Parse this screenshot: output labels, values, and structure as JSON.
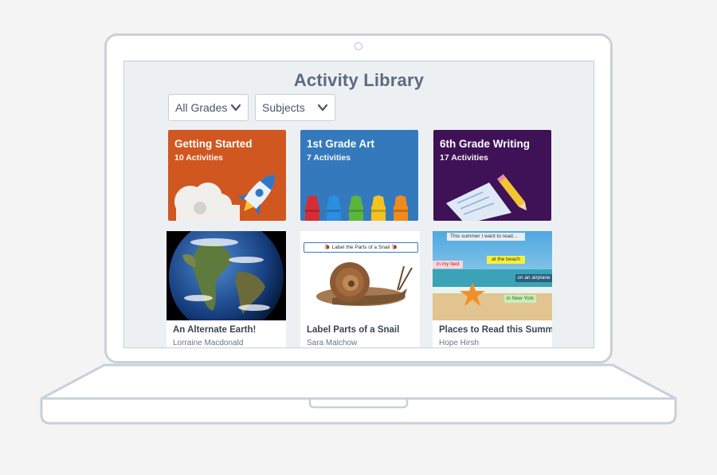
{
  "page": {
    "title": "Activity Library"
  },
  "filters": {
    "grades_label": "All Grades",
    "subjects_label": "Subjects"
  },
  "collections": [
    {
      "title": "Getting Started",
      "count": "10 Activities",
      "color": "#d0571f",
      "icon": "rocket-and-cloud-icon"
    },
    {
      "title": "1st Grade Art",
      "count": "7 Activities",
      "color": "#3579bd",
      "icon": "crayons-icon"
    },
    {
      "title": "6th Grade Writing",
      "count": "17 Activities",
      "color": "#3f1257",
      "icon": "paper-and-pencil-icon"
    }
  ],
  "activities": [
    {
      "title": "An Alternate Earth!",
      "author": "Lorraine Macdonald",
      "thumbnail": "earth-globe"
    },
    {
      "title": "Label Parts of a Snail",
      "author": "Sara Malchow",
      "thumbnail": "snail-photo",
      "thumb_banner": "🐌 Label the Parts of a Snail 🐌"
    },
    {
      "title": "Places to Read this Summer",
      "author": "Hope Hirsh",
      "thumbnail": "beach-starfish",
      "thumb_labels": [
        "This summer I want to read...",
        "at the beach",
        "in my bed",
        "on an airplane",
        "in New York"
      ]
    }
  ]
}
